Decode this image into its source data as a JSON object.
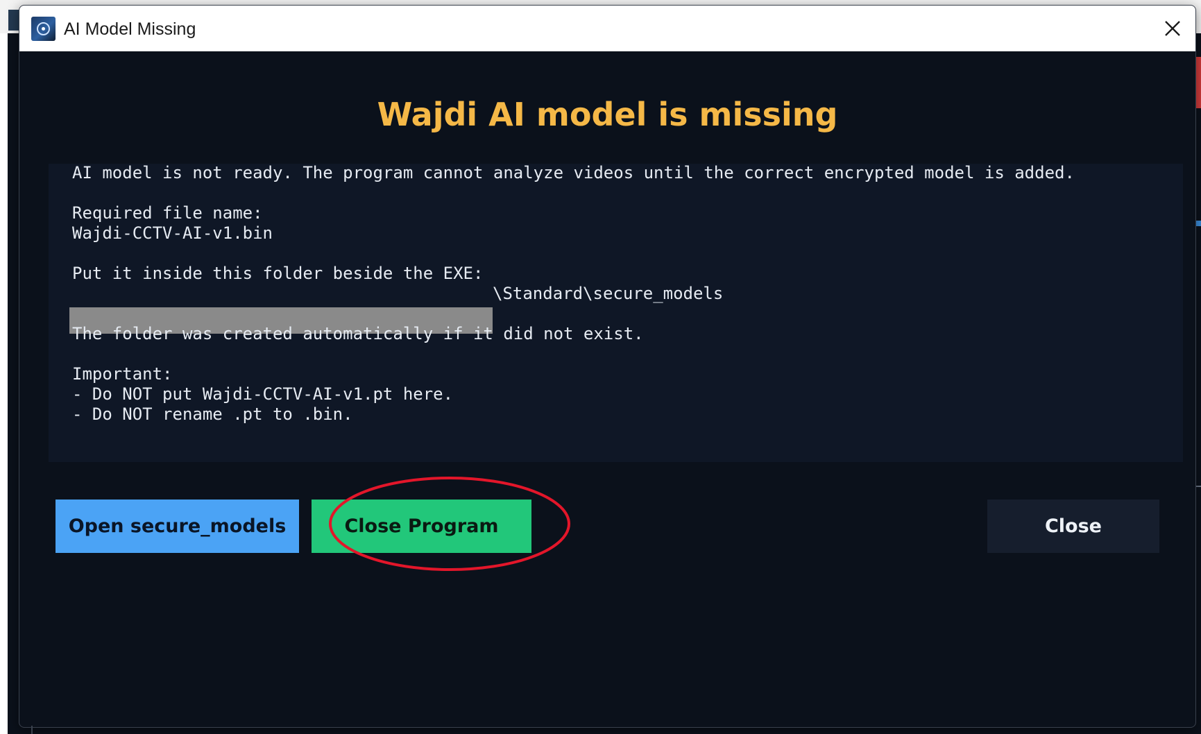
{
  "window": {
    "title": "AI Model Missing",
    "close_label": "Close window"
  },
  "dialog": {
    "heading": "Wajdi AI model is missing",
    "message": {
      "line1": "AI model is not ready. The program cannot analyze videos until the correct encrypted model is added.",
      "line2": "Required file name:",
      "line3": "Wajdi-CCTV-AI-v1.bin",
      "line4": "Put it inside this folder beside the EXE:",
      "line5": "\\Standard\\secure_models",
      "line6": "The folder was created automatically if it did not exist.",
      "line7": "Important:",
      "line8": "- Do NOT put Wajdi-CCTV-AI-v1.pt here.",
      "line9": "- Do NOT rename .pt to .bin."
    },
    "buttons": {
      "open_label": "Open secure_models",
      "close_program_label": "Close Program",
      "close_label": "Close"
    }
  },
  "colors": {
    "heading": "#f5b847",
    "open_button": "#4ba3f5",
    "close_program_button": "#22c77a",
    "close_button": "#161e2d",
    "dialog_background": "#0b111b",
    "annotation": "#e3162a"
  },
  "icons": {
    "app": "app-logo-icon",
    "close": "close-icon"
  }
}
